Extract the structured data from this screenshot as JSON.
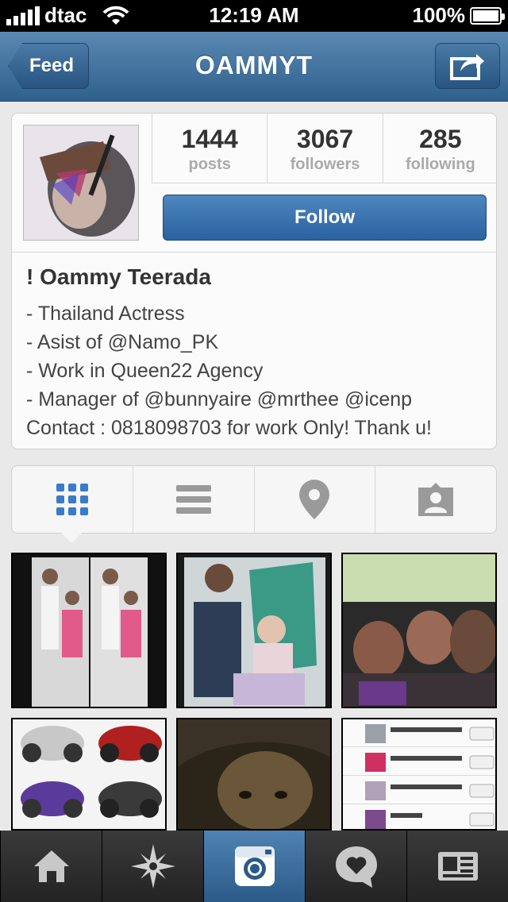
{
  "status_bar": {
    "carrier": "dtac",
    "time": "12:19 AM",
    "battery": "100%"
  },
  "nav": {
    "back_label": "Feed",
    "title": "OAMMYT"
  },
  "profile": {
    "stats": [
      {
        "value": "1444",
        "label": "posts"
      },
      {
        "value": "3067",
        "label": "followers"
      },
      {
        "value": "285",
        "label": "following"
      }
    ],
    "follow_label": "Follow",
    "name": "! Oammy Teerada",
    "bio": [
      "- Thailand Actress",
      "- Asist of @Namo_PK",
      "- Work in Queen22 Agency",
      "- Manager of @bunnyaire @mrthee @icenp",
      "Contact : 0818098703 for work Only! Thank u!"
    ]
  },
  "view_tabs": [
    "grid-icon",
    "list-icon",
    "location-pin-icon",
    "tagged-photos-icon"
  ],
  "bottom_tabs": [
    "home-icon",
    "explore-icon",
    "camera-icon",
    "activity-icon",
    "profile-icon"
  ]
}
